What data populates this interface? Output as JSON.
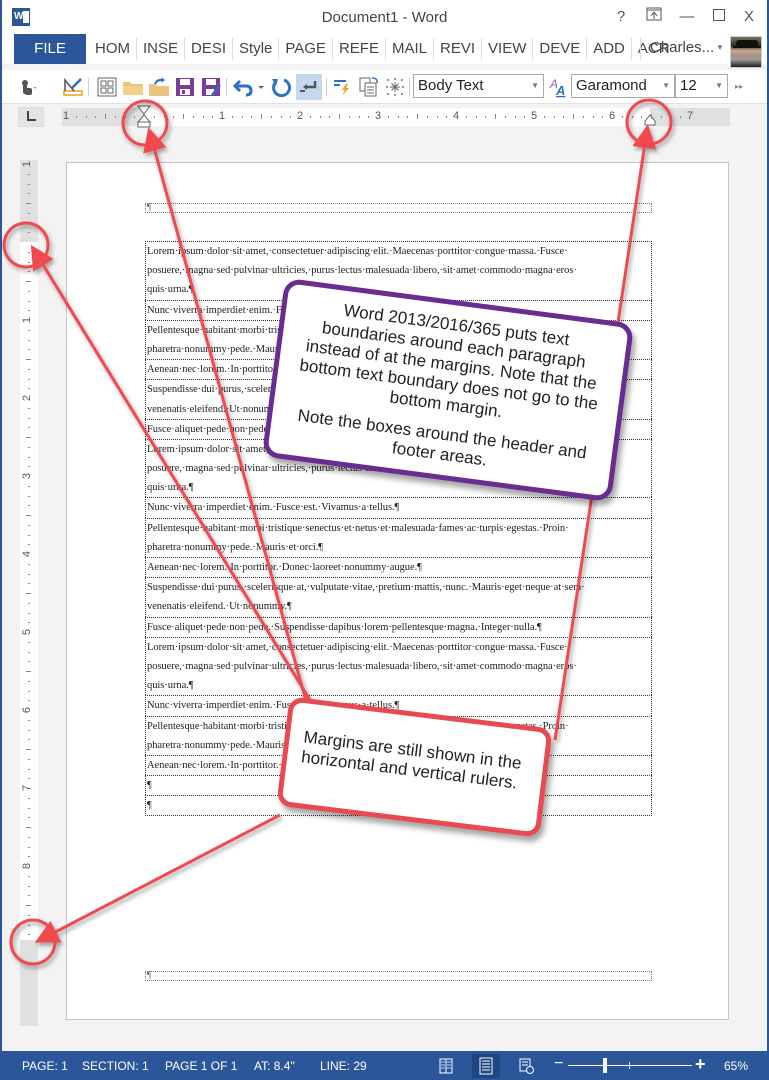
{
  "window": {
    "title": "Document1 - Word",
    "help_label": "?",
    "ribbon_display_label": "⬆",
    "minimize_label": "—",
    "maximize_label": "☐",
    "close_label": "X"
  },
  "ribbon": {
    "file_tab": "FILE",
    "tabs": [
      "HOM",
      "INSE",
      "DESI",
      "Style",
      "PAGE",
      "REFE",
      "MAIL",
      "REVI",
      "VIEW",
      "DEVE",
      "ADD",
      "ACR"
    ],
    "user_name": "Charles..."
  },
  "toolbar": {
    "icons": [
      "touch-mode-icon",
      "ruler-edit-icon",
      "grid-icon",
      "open-folder-icon",
      "folder-up-icon",
      "save-icon",
      "save-as-icon",
      "undo-icon",
      "redo-icon",
      "return-icon",
      "styles-flash-icon",
      "copy-format-icon",
      "sparkle-icon"
    ],
    "style_value": "Body Text",
    "font_value": "Garamond",
    "size_value": "12",
    "overflow_label": "▸▸"
  },
  "rulers": {
    "horizontal_labels": [
      "1",
      "1",
      "2",
      "3",
      "4",
      "5",
      "6",
      "7"
    ],
    "vertical_labels": [
      "1",
      "1",
      "2",
      "3",
      "4",
      "5",
      "6",
      "7",
      "8"
    ]
  },
  "document": {
    "header_mark": "¶",
    "footer_mark": "¶",
    "paragraphs": [
      {
        "lines": [
          "Lorem·ipsum·dolor·sit·amet,·consectetuer·adipiscing·elit.·Maecenas·porttitor·congue·massa.·Fusce·",
          "posuere,·magna·sed·pulvinar·ultricies,·purus·lectus·malesuada·libero,·sit·amet·commodo·magna·eros·",
          "quis·urna.¶"
        ]
      },
      {
        "lines": [
          "Nunc·viverra·imperdiet·enim.·Fusce·est.·Vivamus·a·tellus.¶"
        ]
      },
      {
        "lines": [
          "Pellentesque·habitant·morbi·tristique·senectus·et·netus·et·malesuada·fames·ac·turpis·egestas.·Proin·",
          "pharetra·nonummy·pede.·Mauris·et·orci.¶"
        ]
      },
      {
        "lines": [
          "Aenean·nec·lorem.·In·porttitor.·Donec·laoreet·nonummy·augue.¶"
        ]
      },
      {
        "lines": [
          "Suspendisse·dui·purus,·scelerisque·at,·vulputate·vitae,·pretium·mattis,·nunc.·Mauris·eget·neque·at·sem·",
          "venenatis·eleifend.·Ut·nonummy.¶"
        ]
      },
      {
        "lines": [
          "Fusce·aliquet·pede·non·pede.·Suspendisse·dapibus·lorem·pellentesque·magna.·Integer·nulla.¶"
        ]
      },
      {
        "lines": [
          "Lorem·ipsum·dolor·sit·amet,·consectetuer·adipiscing·elit.·Maecenas·porttitor·congue·massa.·Fusce·",
          "posuere,·magna·sed·pulvinar·ultricies,·purus·lectus·malesuada·libero,·sit·amet·commodo·magna·eros·",
          "quis·urna.¶"
        ]
      },
      {
        "lines": [
          "Nunc·viverra·imperdiet·enim.·Fusce·est.·Vivamus·a·tellus.¶"
        ]
      },
      {
        "lines": [
          "Pellentesque·habitant·morbi·tristique·senectus·et·netus·et·malesuada·fames·ac·turpis·egestas.·Proin·",
          "pharetra·nonummy·pede.·Mauris·et·orci.¶"
        ]
      },
      {
        "lines": [
          "Aenean·nec·lorem.·In·porttitor.·Donec·laoreet·nonummy·augue.¶"
        ]
      },
      {
        "lines": [
          "Suspendisse·dui·purus,·scelerisque·at,·vulputate·vitae,·pretium·mattis,·nunc.·Mauris·eget·neque·at·sem·",
          "venenatis·eleifend.·Ut·nonummy.¶"
        ]
      },
      {
        "lines": [
          "Fusce·aliquet·pede·non·pede.·Suspendisse·dapibus·lorem·pellentesque·magna.·Integer·nulla.¶"
        ]
      },
      {
        "lines": [
          "Lorem·ipsum·dolor·sit·amet,·consectetuer·adipiscing·elit.·Maecenas·porttitor·congue·massa.·Fusce·",
          "posuere,·magna·sed·pulvinar·ultricies,·purus·lectus·malesuada·libero,·sit·amet·commodo·magna·eros·",
          "quis·urna.¶"
        ]
      },
      {
        "lines": [
          "Nunc·viverra·imperdiet·enim.·Fusce·est.·Vivamus·a·tellus.¶"
        ]
      },
      {
        "lines": [
          "Pellentesque·habitant·morbi·tristique·senectus·et·netus·et·malesuada·fames·ac·turpis·egestas.·Proin·",
          "pharetra·nonummy·pede.·Mauris·et·orci.¶"
        ]
      },
      {
        "lines": [
          "Aenean·nec·lorem.·In·porttitor.·Donec·laoreet·nonummy·augue.¶"
        ]
      },
      {
        "lines": [
          "¶"
        ]
      },
      {
        "lines": [
          "¶"
        ]
      }
    ]
  },
  "annotations": {
    "callout_1": {
      "paragraph_1": "Word 2013/2016/365 puts text boundaries around each paragraph instead of at the margins. Note that the bottom text boundary does not go to the bottom margin.",
      "paragraph_2": "Note the boxes around the header and footer areas.",
      "border_color": "#6a2c91"
    },
    "callout_2": {
      "text": "Margins are still shown in the horizontal and vertical rulers.",
      "border_color": "#e84a4f"
    },
    "arrow_color": "#f04a50"
  },
  "statusbar": {
    "page": "PAGE: 1",
    "section": "SECTION: 1",
    "page_of": "PAGE 1 OF 1",
    "at": "AT: 8.4\"",
    "line": "LINE: 29",
    "zoom_minus": "−",
    "zoom_plus": "+",
    "zoom_level": "65%",
    "zoom_percent": 65
  },
  "colors": {
    "accent": "#2b579a"
  }
}
